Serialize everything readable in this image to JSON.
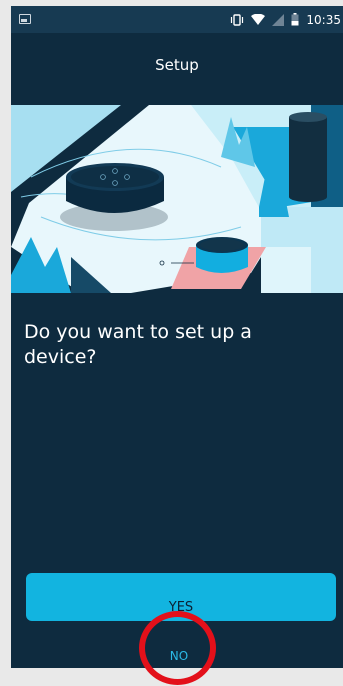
{
  "status_bar": {
    "time": "10:35",
    "icons": [
      "image-icon",
      "vibrate-icon",
      "wifi-icon",
      "signal-icon",
      "battery-icon"
    ]
  },
  "header": {
    "title": "Setup"
  },
  "main": {
    "question": "Do you want to set up a device?",
    "illustration": "echo-dot-illustration"
  },
  "actions": {
    "yes_label": "YES",
    "no_label": "NO"
  },
  "colors": {
    "background": "#0e2b3f",
    "accent": "#12b4e0",
    "annotation": "#e3101a"
  }
}
